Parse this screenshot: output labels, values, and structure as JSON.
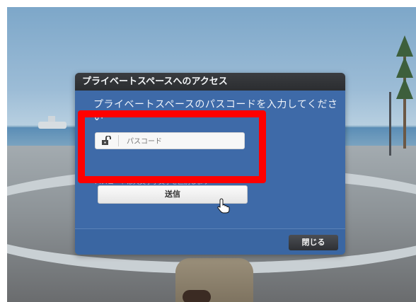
{
  "dialog": {
    "title": "プライベートスペースへのアクセス",
    "prompt": "プライベートスペースのパスコードを入力してください",
    "passcode_placeholder": "パスコード",
    "hint": "パスコードは大文字小文字を区別します",
    "send_label": "送信",
    "close_label": "閉じる"
  },
  "icons": {
    "lock": "unlocked-padlock-icon",
    "cursor": "hand-pointer-icon"
  },
  "colors": {
    "dialog_bg": "#3e6aa8",
    "title_bar": "#2b2d30",
    "highlight": "#ff0000"
  }
}
